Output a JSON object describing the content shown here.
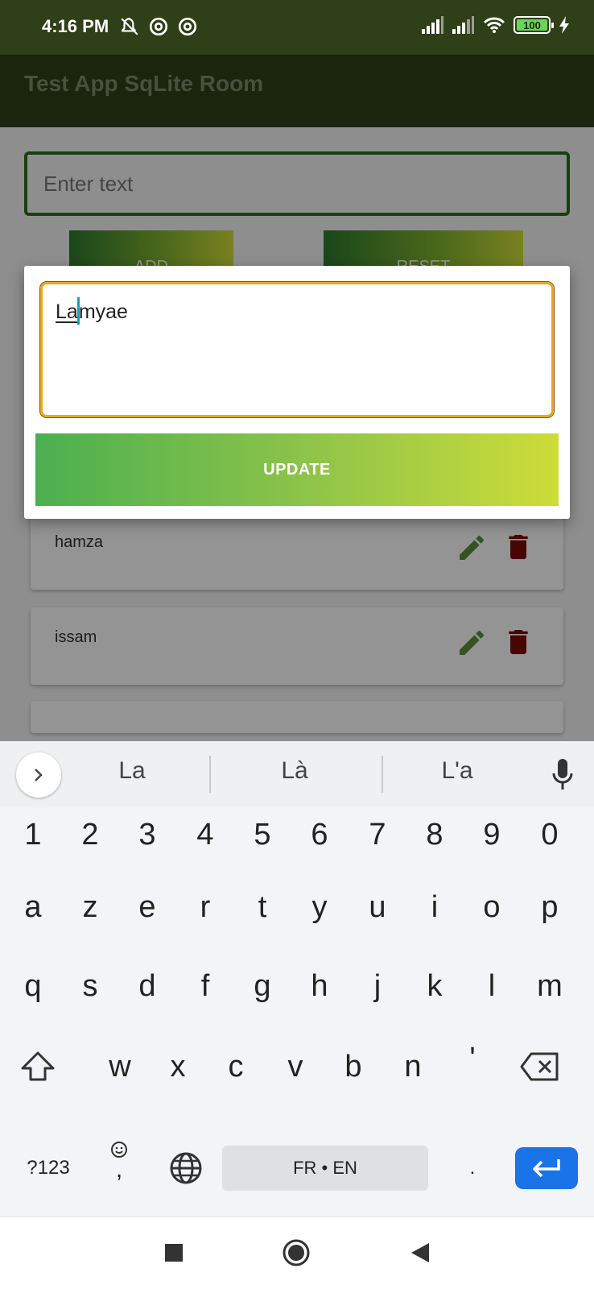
{
  "status_bar": {
    "time": "4:16 PM",
    "battery": "100",
    "left_icons": [
      "notifications-off-icon",
      "data-saver-icon",
      "data-saver-icon"
    ],
    "right_icons": [
      "signal-icon",
      "signal-icon",
      "wifi-icon",
      "battery-icon",
      "charging-icon"
    ]
  },
  "app_bar": {
    "title": "Test App SqLite Room"
  },
  "main": {
    "input_placeholder": "Enter text",
    "add_label": "ADD",
    "reset_label": "RESET",
    "items": [
      {
        "label": "hamza"
      },
      {
        "label": "issam"
      }
    ]
  },
  "dialog": {
    "input_text_underlined": "La",
    "input_text_rest": "myae",
    "update_label": "UPDATE"
  },
  "keyboard": {
    "suggestions": [
      "La",
      "Là",
      "L'a"
    ],
    "number_row": [
      "1",
      "2",
      "3",
      "4",
      "5",
      "6",
      "7",
      "8",
      "9",
      "0"
    ],
    "row1": [
      "a",
      "z",
      "e",
      "r",
      "t",
      "y",
      "u",
      "i",
      "o",
      "p"
    ],
    "row2": [
      "q",
      "s",
      "d",
      "f",
      "g",
      "h",
      "j",
      "k",
      "l",
      "m"
    ],
    "row3": [
      "w",
      "x",
      "c",
      "v",
      "b",
      "n",
      "'"
    ],
    "symbols_label": "?123",
    "emoji_comma": ",",
    "space_label": "FR • EN",
    "period": "."
  },
  "colors": {
    "app_bar": "#2f3f17",
    "accent_green": "#4caf50",
    "accent_lime": "#cddc39",
    "edit_icon": "#5f8e3a",
    "delete_icon": "#7a0a0a",
    "enter_key": "#1a73e8",
    "dialog_border": "#e8a823"
  }
}
